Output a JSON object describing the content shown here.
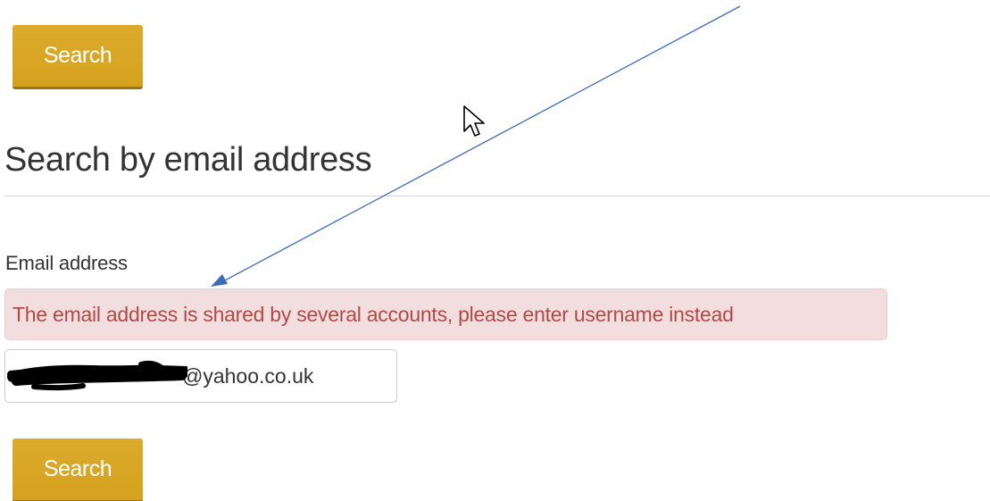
{
  "top_button": {
    "label": "Search"
  },
  "section": {
    "heading": "Search by email address"
  },
  "email_field": {
    "label": "Email address",
    "error_message": "The email address is shared by several accounts, please enter username instead",
    "value_visible": "@yahoo.co.uk"
  },
  "bottom_button": {
    "label": "Search"
  },
  "colors": {
    "button": "#daa520",
    "error_background": "#f2dede",
    "error_text": "#b14a47",
    "annotation_arrow": "#3b6cb7"
  },
  "icons": {
    "cursor": "mouse-pointer-icon",
    "annotation": "arrow-annotation-icon",
    "redaction": "redaction-scribble"
  }
}
